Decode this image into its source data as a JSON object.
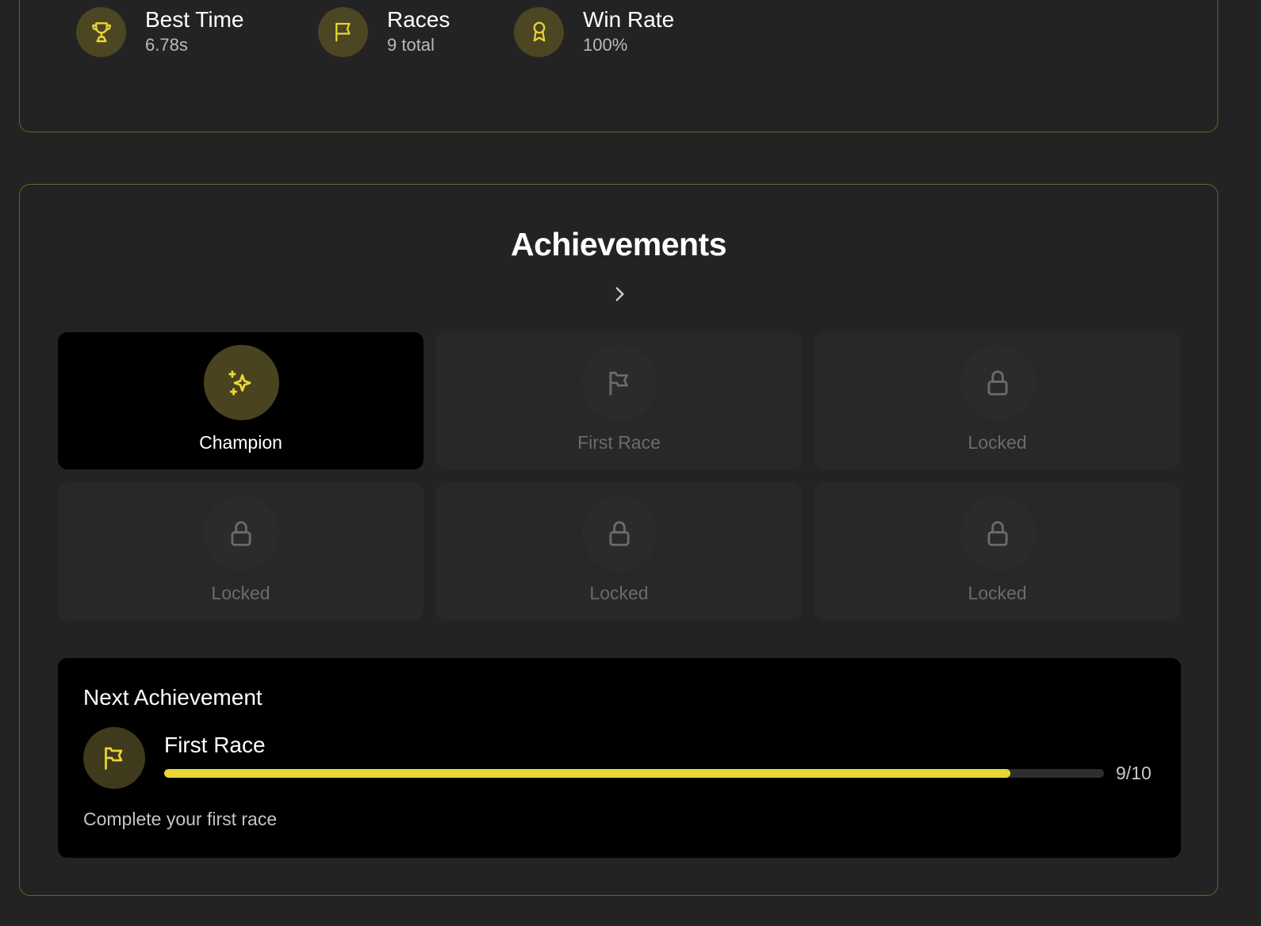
{
  "stats": [
    {
      "icon": "trophy-icon",
      "title": "Best Time",
      "value": "6.78s"
    },
    {
      "icon": "flag-icon",
      "title": "Races",
      "value": "9 total"
    },
    {
      "icon": "award-icon",
      "title": "Win Rate",
      "value": "100%"
    }
  ],
  "achievements": {
    "title": "Achievements",
    "tiles": [
      {
        "icon": "sparkles-icon",
        "label": "Champion",
        "unlocked": true
      },
      {
        "icon": "flag-icon",
        "label": "First Race",
        "unlocked": false
      },
      {
        "icon": "lock-icon",
        "label": "Locked",
        "unlocked": false
      },
      {
        "icon": "lock-icon",
        "label": "Locked",
        "unlocked": false
      },
      {
        "icon": "lock-icon",
        "label": "Locked",
        "unlocked": false
      },
      {
        "icon": "lock-icon",
        "label": "Locked",
        "unlocked": false
      }
    ]
  },
  "next": {
    "heading": "Next Achievement",
    "icon": "flag-icon",
    "name": "First Race",
    "progress": 0.9,
    "count": "9/10",
    "description": "Complete your first race"
  },
  "colors": {
    "accent": "#e9d633",
    "card_border": "#6b6226",
    "background": "#232323"
  }
}
